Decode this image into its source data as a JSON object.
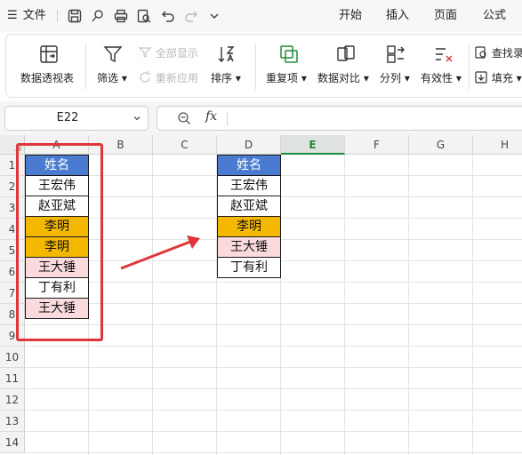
{
  "menubar": {
    "hamburger": "☰",
    "file_label": "文件",
    "tabs": [
      "开始",
      "插入",
      "页面",
      "公式"
    ]
  },
  "ribbon": {
    "pivot_table": "数据透视表",
    "filter": "筛选",
    "show_all": "全部显示",
    "reapply": "重新应用",
    "sort": "排序",
    "duplicates": "重复项",
    "compare": "数据对比",
    "split": "分列",
    "validity": "有效性",
    "find_record": "查找录",
    "fill": "填充"
  },
  "formula_bar": {
    "name_box": "E22",
    "fx": "fx",
    "formula": ""
  },
  "columns": [
    "A",
    "B",
    "C",
    "D",
    "E",
    "F",
    "G",
    "H"
  ],
  "active_column": "E",
  "rows": [
    "1",
    "2",
    "3",
    "4",
    "5",
    "6",
    "7",
    "8",
    "9",
    "10",
    "11",
    "12",
    "13",
    "14"
  ],
  "colors": {
    "header_fill": "#4a7bd0",
    "highlight_orange": "#f5b800",
    "highlight_pink": "#fadadd",
    "annotation_red": "#e0353a",
    "active_green": "#1e8a3c"
  },
  "column_a": [
    {
      "text": "姓名",
      "fill": "header"
    },
    {
      "text": "王宏伟",
      "fill": "none"
    },
    {
      "text": "赵亚斌",
      "fill": "none"
    },
    {
      "text": "李明",
      "fill": "orange"
    },
    {
      "text": "李明",
      "fill": "orange"
    },
    {
      "text": "王大锤",
      "fill": "pink"
    },
    {
      "text": "丁有利",
      "fill": "none"
    },
    {
      "text": "王大锤",
      "fill": "pink"
    }
  ],
  "column_d": [
    {
      "text": "姓名",
      "fill": "header"
    },
    {
      "text": "王宏伟",
      "fill": "none"
    },
    {
      "text": "赵亚斌",
      "fill": "none"
    },
    {
      "text": "李明",
      "fill": "orange"
    },
    {
      "text": "王大锤",
      "fill": "pink"
    },
    {
      "text": "丁有利",
      "fill": "none"
    }
  ]
}
